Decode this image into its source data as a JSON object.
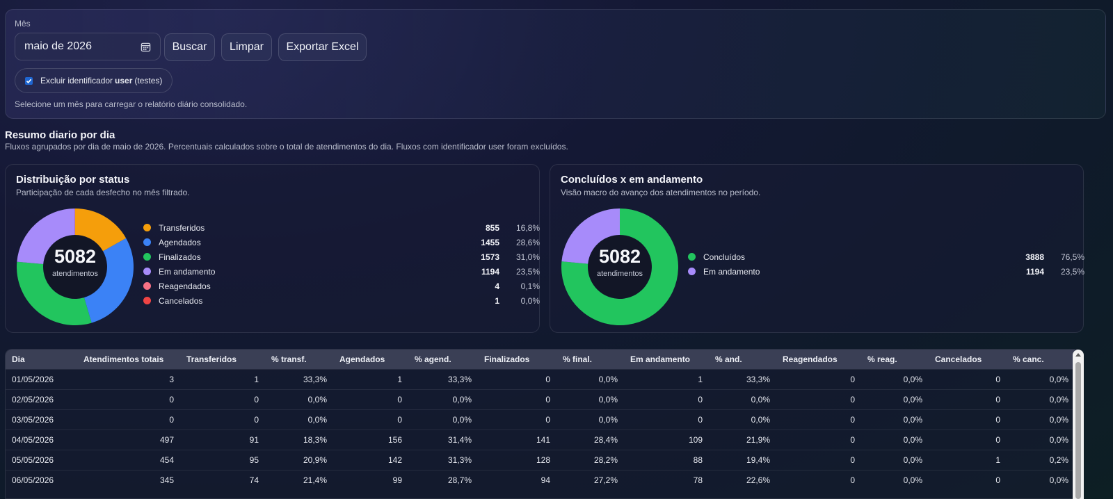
{
  "filter": {
    "month_label": "Mês",
    "month_value": "maio de 2026",
    "buttons": {
      "search": "Buscar",
      "clear": "Limpar",
      "export": "Exportar Excel"
    },
    "checkbox": {
      "checked": true,
      "prefix": "Excluir identificador",
      "bold": "user",
      "suffix": "(testes)"
    },
    "hint": "Selecione um mês para carregar o relatório diário consolidado."
  },
  "summary": {
    "title": "Resumo diario por dia",
    "subtitle": "Fluxos agrupados por dia de maio de 2026. Percentuais calculados sobre o total de atendimentos do dia. Fluxos com identificador user foram excluídos."
  },
  "status_card": {
    "title": "Distribuição por status",
    "subtitle": "Participação de cada desfecho no mês filtrado.",
    "total": "5082",
    "total_label": "atendimentos",
    "items": [
      {
        "name": "Transferidos",
        "count": "855",
        "pct": "16,8%",
        "value": 855,
        "color": "#f59e0b"
      },
      {
        "name": "Agendados",
        "count": "1455",
        "pct": "28,6%",
        "value": 1455,
        "color": "#3b82f6"
      },
      {
        "name": "Finalizados",
        "count": "1573",
        "pct": "31,0%",
        "value": 1573,
        "color": "#22c55e"
      },
      {
        "name": "Em andamento",
        "count": "1194",
        "pct": "23,5%",
        "value": 1194,
        "color": "#a78bfa"
      },
      {
        "name": "Reagendados",
        "count": "4",
        "pct": "0,1%",
        "value": 4,
        "color": "#f87185"
      },
      {
        "name": "Cancelados",
        "count": "1",
        "pct": "0,0%",
        "value": 1,
        "color": "#ef4444"
      }
    ]
  },
  "progress_card": {
    "title": "Concluídos x em andamento",
    "subtitle": "Visão macro do avanço dos atendimentos no período.",
    "total": "5082",
    "total_label": "atendimentos",
    "items": [
      {
        "name": "Concluídos",
        "count": "3888",
        "pct": "76,5%",
        "value": 3888,
        "color": "#22c55e"
      },
      {
        "name": "Em andamento",
        "count": "1194",
        "pct": "23,5%",
        "value": 1194,
        "color": "#a78bfa"
      }
    ]
  },
  "table": {
    "headers": [
      "Dia",
      "Atendimentos totais",
      "Transferidos",
      "% transf.",
      "Agendados",
      "% agend.",
      "Finalizados",
      "% final.",
      "Em andamento",
      "% and.",
      "Reagendados",
      "% reag.",
      "Cancelados",
      "% canc."
    ],
    "rows": [
      [
        "01/05/2026",
        "3",
        "1",
        "33,3%",
        "1",
        "33,3%",
        "0",
        "0,0%",
        "1",
        "33,3%",
        "0",
        "0,0%",
        "0",
        "0,0%"
      ],
      [
        "02/05/2026",
        "0",
        "0",
        "0,0%",
        "0",
        "0,0%",
        "0",
        "0,0%",
        "0",
        "0,0%",
        "0",
        "0,0%",
        "0",
        "0,0%"
      ],
      [
        "03/05/2026",
        "0",
        "0",
        "0,0%",
        "0",
        "0,0%",
        "0",
        "0,0%",
        "0",
        "0,0%",
        "0",
        "0,0%",
        "0",
        "0,0%"
      ],
      [
        "04/05/2026",
        "497",
        "91",
        "18,3%",
        "156",
        "31,4%",
        "141",
        "28,4%",
        "109",
        "21,9%",
        "0",
        "0,0%",
        "0",
        "0,0%"
      ],
      [
        "05/05/2026",
        "454",
        "95",
        "20,9%",
        "142",
        "31,3%",
        "128",
        "28,2%",
        "88",
        "19,4%",
        "0",
        "0,0%",
        "1",
        "0,2%"
      ],
      [
        "06/05/2026",
        "345",
        "74",
        "21,4%",
        "99",
        "28,7%",
        "94",
        "27,2%",
        "78",
        "22,6%",
        "0",
        "0,0%",
        "0",
        "0,0%"
      ]
    ]
  }
}
